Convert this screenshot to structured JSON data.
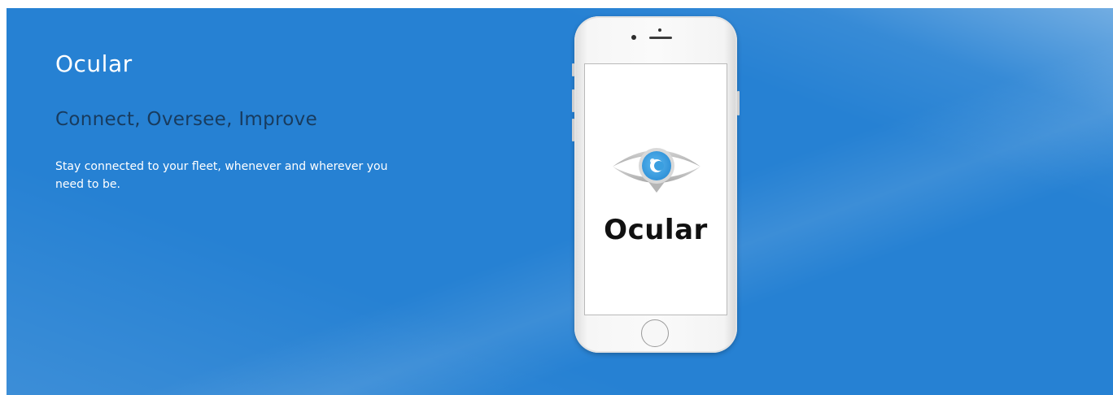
{
  "hero": {
    "title": "Ocular",
    "subtitle": "Connect, Oversee, Improve",
    "description": "Stay connected to your fleet, whenever and wherever you need to be.",
    "background_color": "#2681d3"
  },
  "phone": {
    "app_name": "Ocular",
    "logo_icon": "eye-icon",
    "logo_colors": {
      "iris": "#3a9fe0",
      "eye_outline": "#b9b9b9",
      "text": "#111111"
    }
  }
}
